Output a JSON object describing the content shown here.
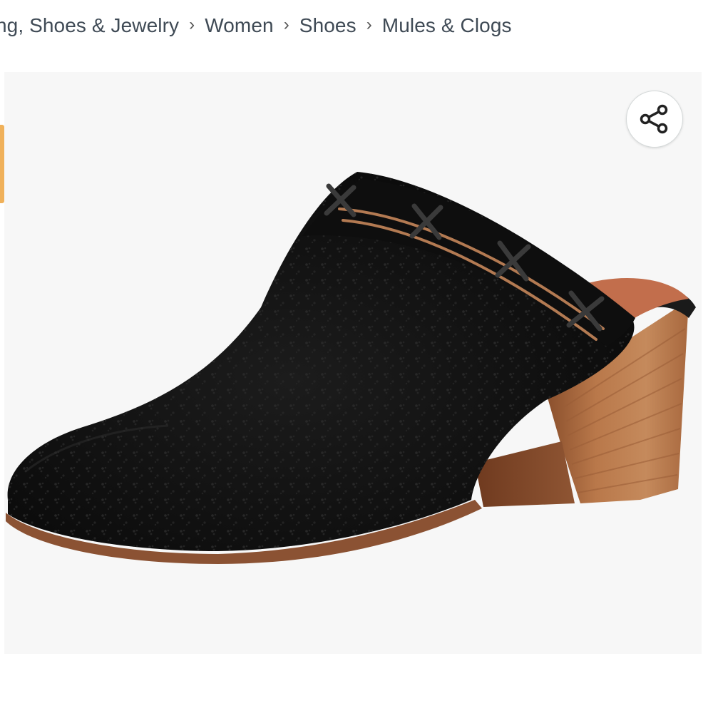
{
  "breadcrumb": {
    "items": [
      {
        "label": "ng, Shoes & Jewelry"
      },
      {
        "label": "Women"
      },
      {
        "label": "Shoes"
      },
      {
        "label": "Mules & Clogs"
      }
    ],
    "separator": "›"
  },
  "product_image": {
    "subject": "black suede mule with stacked wooden block heel",
    "background_color": "#f7f7f7"
  },
  "share": {
    "icon": "share-icon"
  },
  "colors": {
    "breadcrumb_text": "#3f4a55",
    "accent": "#f0b15a"
  }
}
